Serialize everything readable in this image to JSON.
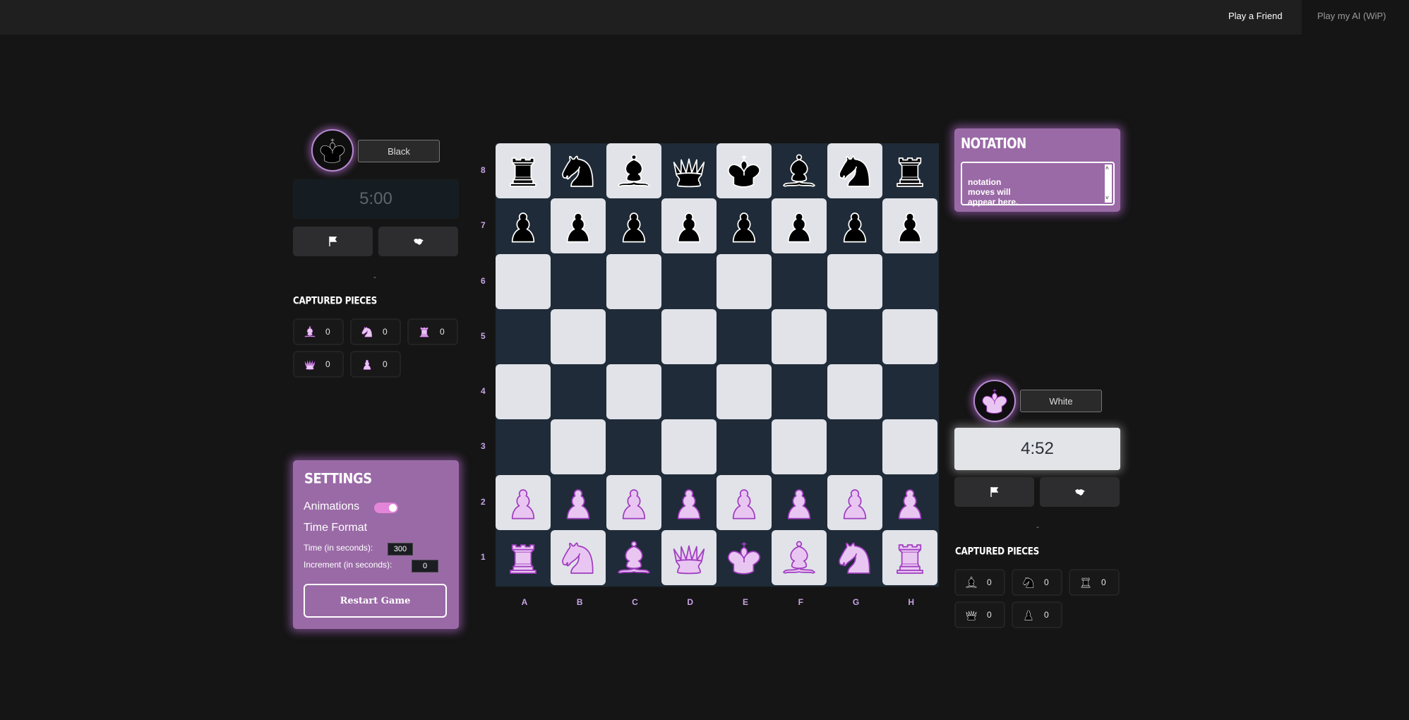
{
  "nav": {
    "play_friend": "Play a Friend",
    "play_ai": "Play my AI (WiP)"
  },
  "black_player": {
    "name": "Black",
    "clock": "5:00",
    "status": "-",
    "captured_title": "CAPTURED PIECES",
    "captured": [
      {
        "piece": "bishop-icon",
        "count": "0"
      },
      {
        "piece": "knight-icon",
        "count": "0"
      },
      {
        "piece": "rook-icon",
        "count": "0"
      },
      {
        "piece": "queen-icon",
        "count": "0"
      },
      {
        "piece": "pawn-icon",
        "count": "0"
      }
    ]
  },
  "white_player": {
    "name": "White",
    "clock": "4:52",
    "status": "-",
    "captured_title": "CAPTURED PIECES",
    "captured": [
      {
        "piece": "bishop-icon",
        "count": "0"
      },
      {
        "piece": "knight-icon",
        "count": "0"
      },
      {
        "piece": "rook-icon",
        "count": "0"
      },
      {
        "piece": "queen-icon",
        "count": "0"
      },
      {
        "piece": "pawn-icon",
        "count": "0"
      }
    ]
  },
  "settings": {
    "title": "SETTINGS",
    "animations_label": "Animations",
    "animations_on": true,
    "time_format_label": "Time Format",
    "time_label": "Time (in seconds):",
    "time_value": "300",
    "increment_label": "Increment (in seconds):",
    "increment_value": "0",
    "restart_label": "Restart Game"
  },
  "notation": {
    "title": "NOTATION",
    "placeholder": "notation\nmoves will\nappear here."
  },
  "board": {
    "ranks": [
      "8",
      "7",
      "6",
      "5",
      "4",
      "3",
      "2",
      "1"
    ],
    "files": [
      "A",
      "B",
      "C",
      "D",
      "E",
      "F",
      "G",
      "H"
    ],
    "position": [
      [
        "bR",
        "bN",
        "bB",
        "bQ",
        "bK",
        "bB",
        "bN",
        "bR"
      ],
      [
        "bP",
        "bP",
        "bP",
        "bP",
        "bP",
        "bP",
        "bP",
        "bP"
      ],
      [
        "",
        "",
        "",
        "",
        "",
        "",
        "",
        ""
      ],
      [
        "",
        "",
        "",
        "",
        "",
        "",
        "",
        ""
      ],
      [
        "",
        "",
        "",
        "",
        "",
        "",
        "",
        ""
      ],
      [
        "",
        "",
        "",
        "",
        "",
        "",
        "",
        ""
      ],
      [
        "wP",
        "wP",
        "wP",
        "wP",
        "wP",
        "wP",
        "wP",
        "wP"
      ],
      [
        "wR",
        "wN",
        "wB",
        "wQ",
        "wK",
        "wB",
        "wN",
        "wR"
      ]
    ]
  },
  "colors": {
    "accent": "#9a6aa6",
    "light_square": "#e1e3e8",
    "dark_square": "#1f2b38",
    "white_piece": "#e9c6f2",
    "white_piece_outline": "#a03cc0"
  }
}
